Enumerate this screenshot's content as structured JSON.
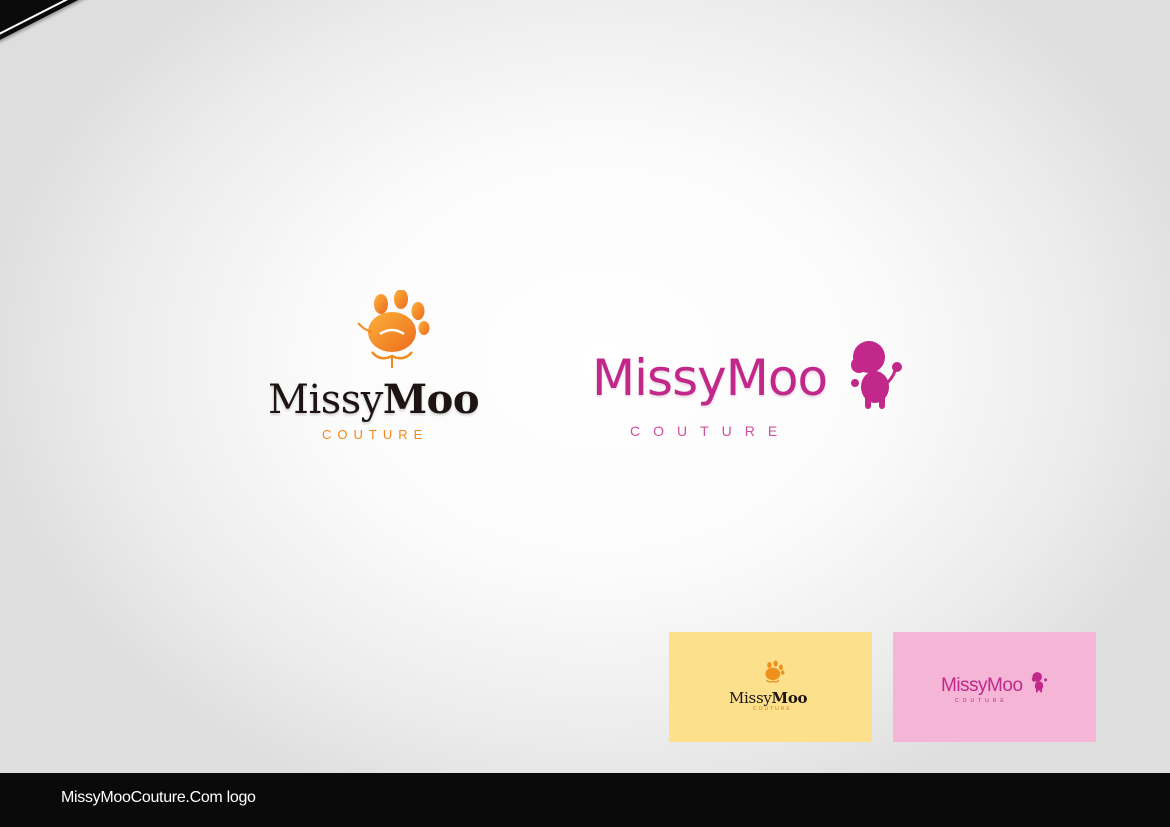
{
  "logo_orange": {
    "name_regular": "Missy",
    "name_bold": "Moo",
    "tagline": "COUTURE",
    "icon": "paw-cat-icon",
    "colors": {
      "text": "#1e1414",
      "accent": "#f08a1a"
    }
  },
  "logo_pink": {
    "name": "MissyMoo",
    "tagline": "COUTURE",
    "icon": "poodle-icon",
    "colors": {
      "text": "#c2278a"
    }
  },
  "swatches": [
    {
      "background": "#fde08c",
      "name_regular": "Missy",
      "name_bold": "Moo",
      "tagline": "COUTURE",
      "icon": "paw-cat-icon"
    },
    {
      "background": "#f4b5d7",
      "name": "MissyMoo",
      "tagline": "COUTURE",
      "icon": "poodle-icon"
    }
  ],
  "footer": {
    "caption": "MissyMooCouture.Com logo"
  }
}
